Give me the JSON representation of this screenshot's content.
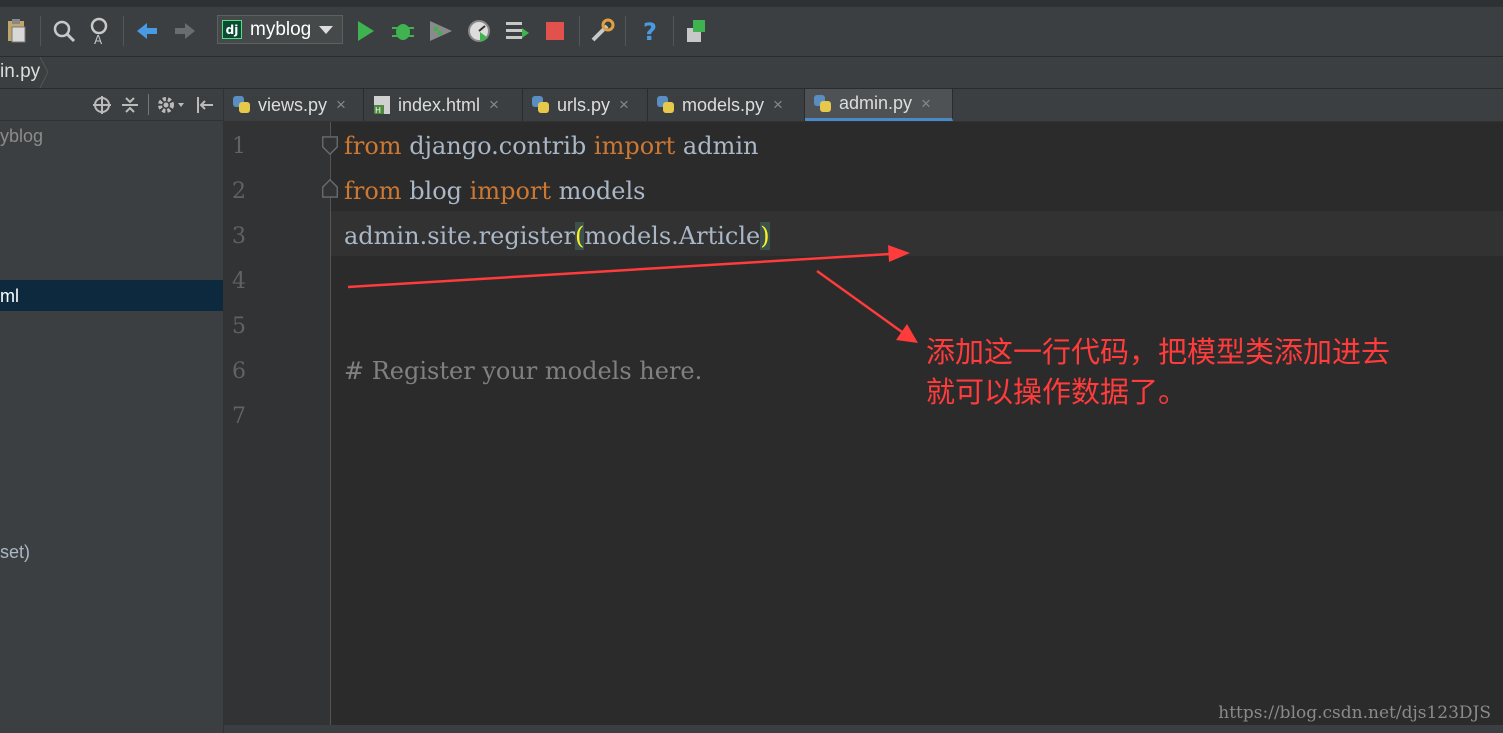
{
  "toolbar": {
    "run_config_label": "myblog",
    "run_config_icon": "dj",
    "icons": [
      "clipboard-icon",
      "find-icon",
      "find-replace-icon",
      "back-icon",
      "forward-icon",
      "run-icon",
      "debug-icon",
      "coverage-icon",
      "profile-icon",
      "build-icon",
      "stop-icon",
      "settings-icon",
      "help-icon",
      "sdk-icon"
    ]
  },
  "navbar": {
    "breadcrumb": "in.py"
  },
  "sidebar": {
    "project_root": "yblog",
    "selected_item": "ml",
    "item_set": "set)"
  },
  "tabs": [
    {
      "label": "views.py",
      "type": "python",
      "close": "×"
    },
    {
      "label": "index.html",
      "type": "html",
      "close": "×"
    },
    {
      "label": "urls.py",
      "type": "python",
      "close": "×"
    },
    {
      "label": "models.py",
      "type": "python",
      "close": "×"
    },
    {
      "label": "admin.py",
      "type": "python",
      "close": "×",
      "active": true
    }
  ],
  "editor": {
    "line_numbers": [
      "1",
      "2",
      "3",
      "4",
      "5",
      "6",
      "7"
    ],
    "lines": {
      "l1": {
        "kw1": "from",
        "t1": " django.contrib ",
        "kw2": "import",
        "t2": " admin"
      },
      "l2": {
        "kw1": "from",
        "t1": " blog ",
        "kw2": "import",
        "t2": " models"
      },
      "l3": {
        "t1": "admin.site.register",
        "p_open": "(",
        "t2": "models.Article",
        "p_close": ")"
      },
      "l6": {
        "comment": "# Register your models here."
      }
    }
  },
  "annotation": {
    "line1": "添加这一行代码，把模型类添加进去",
    "line2": "就可以操作数据了。",
    "color": "#ff3b3b"
  },
  "watermark": "https://blog.csdn.net/djs123DJS",
  "colors": {
    "keyword": "#cc7832",
    "text": "#a9b7c6",
    "comment": "#808080",
    "bracket_match": "#ffef28",
    "tab_active_underline": "#4a88c7",
    "selection": "#0d293e"
  }
}
